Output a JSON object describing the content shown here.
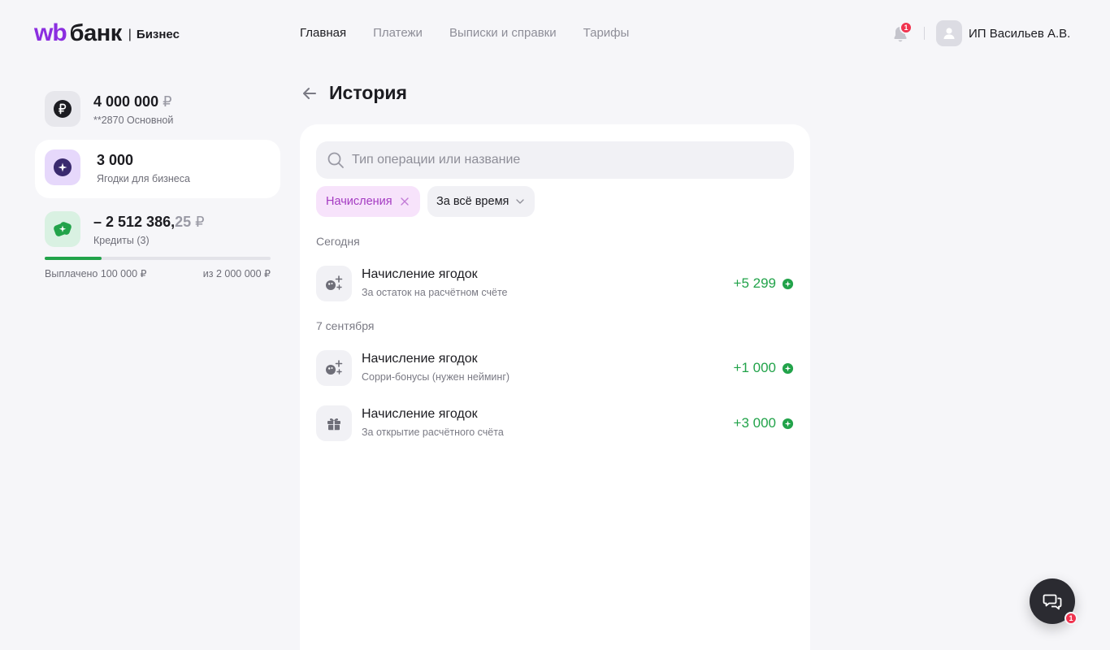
{
  "header": {
    "logo_wb": "wb",
    "logo_bank": "банк",
    "logo_separator": "|",
    "logo_business": "Бизнес",
    "nav": [
      {
        "label": "Главная",
        "active": true
      },
      {
        "label": "Платежи",
        "active": false
      },
      {
        "label": "Выписки и справки",
        "active": false
      },
      {
        "label": "Тарифы",
        "active": false
      }
    ],
    "notifications_count": "1",
    "user_name": "ИП Васильев А.В."
  },
  "sidebar": {
    "accounts": [
      {
        "amount": "4 000 000",
        "currency": "₽",
        "label": "**2870 Основной",
        "icon": "ruble-icon"
      },
      {
        "amount": "3 000",
        "label": "Ягодки для бизнеса",
        "icon": "berry-sparkle-icon",
        "selected": true
      },
      {
        "amount": "– 2 512 386,",
        "fraction": "25",
        "currency": "₽",
        "label": "Кредиты (3)",
        "icon": "credit-icon"
      }
    ],
    "credit_progress": {
      "paid_label": "Выплачено 100 000 ₽",
      "total_label": "из 2 000 000 ₽",
      "fraction": 0.25
    }
  },
  "main": {
    "title": "История",
    "search_placeholder": "Тип операции или название",
    "filters": {
      "active_chip": "Начисления",
      "period_chip": "За всё время"
    },
    "groups": [
      {
        "label": "Сегодня",
        "operations": [
          {
            "title": "Начисление ягодок",
            "subtitle": "За остаток на расчётном счёте",
            "amount": "+5 299",
            "icon": "berries-plus-icon"
          }
        ]
      },
      {
        "label": "7 сентября",
        "operations": [
          {
            "title": "Начисление ягодок",
            "subtitle": "Сорри-бонусы (нужен нейминг)",
            "amount": "+1 000",
            "icon": "berries-plus-icon"
          },
          {
            "title": "Начисление ягодок",
            "subtitle": "За открытие расчётного счёта",
            "amount": "+3 000",
            "icon": "gift-icon"
          }
        ]
      }
    ]
  },
  "chat": {
    "badge": "1"
  },
  "colors": {
    "accent": "#8b2ee0",
    "positive": "#22a34a",
    "chip_bg": "#f7e3fb",
    "chip_text": "#a43ac2",
    "badge": "#f0344f"
  }
}
